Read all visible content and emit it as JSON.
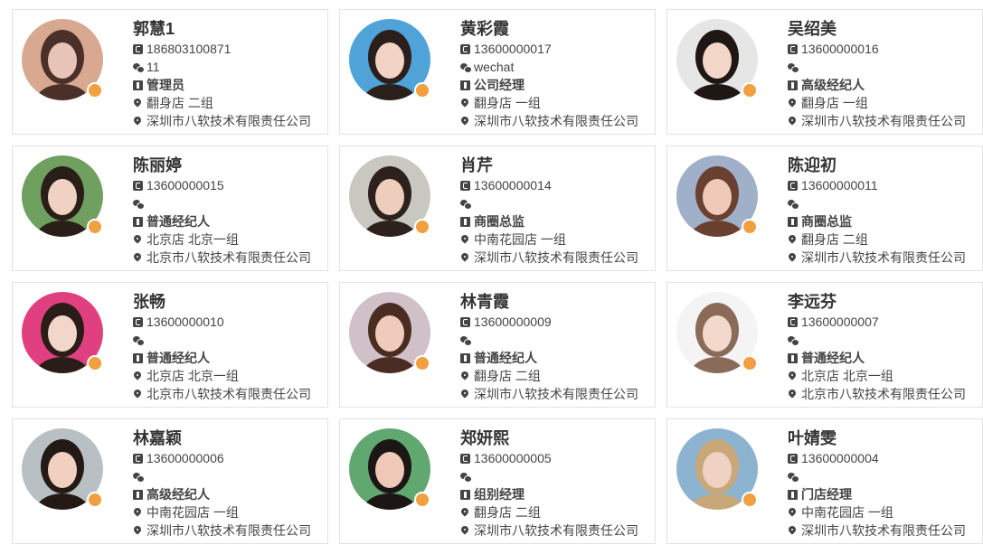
{
  "agents": [
    {
      "name": "郭慧1",
      "phone": "186803100871",
      "wechat": "11",
      "role": "管理员",
      "store": "翻身店 二组",
      "company": "深圳市八软技术有限责任公司",
      "avatar_color": "#e8c4b8",
      "hair_color": "#4a3028",
      "bg_color": "#d9a890"
    },
    {
      "name": "黄彩霞",
      "phone": "13600000017",
      "wechat": "wechat",
      "role": "公司经理",
      "store": "翻身店 一组",
      "company": "深圳市八软技术有限责任公司",
      "avatar_color": "#f3d3c6",
      "hair_color": "#2b1f1c",
      "bg_color": "#4fa3d8"
    },
    {
      "name": "吴绍美",
      "phone": "13600000016",
      "wechat": "",
      "role": "高级经纪人",
      "store": "翻身店 一组",
      "company": "深圳市八软技术有限责任公司",
      "avatar_color": "#f2d6c8",
      "hair_color": "#1e1714",
      "bg_color": "#e6e6e6"
    },
    {
      "name": "陈丽婷",
      "phone": "13600000015",
      "wechat": "",
      "role": "普通经纪人",
      "store": "北京店 北京一组",
      "company": "北京市八软技术有限责任公司",
      "avatar_color": "#f1d2c2",
      "hair_color": "#2a1e18",
      "bg_color": "#6fa060"
    },
    {
      "name": "肖芹",
      "phone": "13600000014",
      "wechat": "",
      "role": "商圈总监",
      "store": "中南花园店 一组",
      "company": "深圳市八软技术有限责任公司",
      "avatar_color": "#efcdbd",
      "hair_color": "#2c211c",
      "bg_color": "#c8c8c0"
    },
    {
      "name": "陈迎初",
      "phone": "13600000011",
      "wechat": "",
      "role": "商圈总监",
      "store": "翻身店 二组",
      "company": "深圳市八软技术有限责任公司",
      "avatar_color": "#f0c9b8",
      "hair_color": "#6a4030",
      "bg_color": "#a0b0c8"
    },
    {
      "name": "张畅",
      "phone": "13600000010",
      "wechat": "",
      "role": "普通经纪人",
      "store": "北京店 北京一组",
      "company": "北京市八软技术有限责任公司",
      "avatar_color": "#f3d6ca",
      "hair_color": "#2a1d18",
      "bg_color": "#e04080"
    },
    {
      "name": "林青霞",
      "phone": "13600000009",
      "wechat": "",
      "role": "普通经纪人",
      "store": "翻身店 二组",
      "company": "深圳市八软技术有限责任公司",
      "avatar_color": "#f0cbbb",
      "hair_color": "#4a2c22",
      "bg_color": "#d0c0c8"
    },
    {
      "name": "李远芬",
      "phone": "13600000007",
      "wechat": "",
      "role": "普通经纪人",
      "store": "北京店 北京一组",
      "company": "北京市八软技术有限责任公司",
      "avatar_color": "#f3d8cc",
      "hair_color": "#8a6a58",
      "bg_color": "#f4f4f4"
    },
    {
      "name": "林嘉颖",
      "phone": "13600000006",
      "wechat": "",
      "role": "高级经纪人",
      "store": "中南花园店 一组",
      "company": "深圳市八软技术有限责任公司",
      "avatar_color": "#f1d0c0",
      "hair_color": "#231a16",
      "bg_color": "#b8c0c4"
    },
    {
      "name": "郑妍熙",
      "phone": "13600000005",
      "wechat": "",
      "role": "组别经理",
      "store": "翻身店 二组",
      "company": "深圳市八软技术有限责任公司",
      "avatar_color": "#f0c8b8",
      "hair_color": "#1c1614",
      "bg_color": "#60a870"
    },
    {
      "name": "叶婧雯",
      "phone": "13600000004",
      "wechat": "",
      "role": "门店经理",
      "store": "中南花园店 一组",
      "company": "深圳市八软技术有限责任公司",
      "avatar_color": "#efd2c4",
      "hair_color": "#c8a878",
      "bg_color": "#8cb4d0"
    }
  ]
}
